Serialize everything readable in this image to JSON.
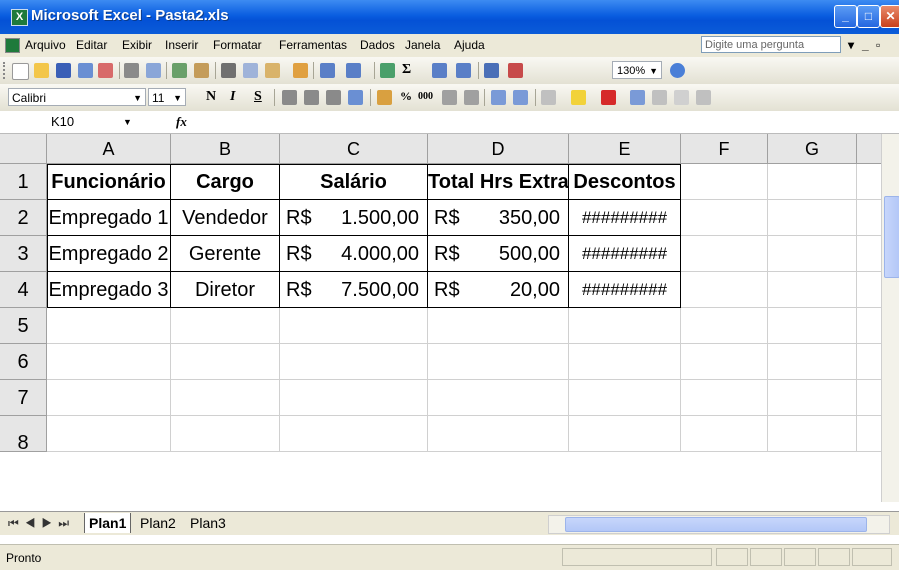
{
  "window": {
    "title": "Microsoft Excel - Pasta2.xls",
    "app_icon": "X"
  },
  "menubar": {
    "items": [
      "Arquivo",
      "Editar",
      "Exibir",
      "Inserir",
      "Formatar",
      "Ferramentas",
      "Dados",
      "Janela",
      "Ajuda"
    ],
    "help_placeholder": "Digite uma pergunta"
  },
  "toolbar": {
    "zoom": "130%",
    "font": "Calibri",
    "font_size": "11",
    "bold": "N",
    "italic": "I",
    "underline": "S"
  },
  "formula_bar": {
    "name_box": "K10",
    "fx": "fx",
    "content": ""
  },
  "columns": [
    "A",
    "B",
    "C",
    "D",
    "E",
    "F",
    "G"
  ],
  "rows": [
    "1",
    "2",
    "3",
    "4",
    "5",
    "6",
    "7",
    "8"
  ],
  "table": {
    "headers": {
      "A": "Funcionário",
      "B": "Cargo",
      "C": "Salário",
      "D": "Total Hrs Extras",
      "E": "Descontos"
    },
    "records": [
      {
        "name": "Empregado 1",
        "cargo": "Vendedor",
        "sal_cur": "R$",
        "sal": "1.500,00",
        "hrs_cur": "R$",
        "hrs": "350,00",
        "desc": "#########"
      },
      {
        "name": "Empregado 2",
        "cargo": "Gerente",
        "sal_cur": "R$",
        "sal": "4.000,00",
        "hrs_cur": "R$",
        "hrs": "500,00",
        "desc": "#########"
      },
      {
        "name": "Empregado 3",
        "cargo": "Diretor",
        "sal_cur": "R$",
        "sal": "7.500,00",
        "hrs_cur": "R$",
        "hrs": "20,00",
        "desc": "#########"
      }
    ]
  },
  "sheet_tabs": [
    "Plan1",
    "Plan2",
    "Plan3"
  ],
  "active_tab": "Plan1",
  "status": "Pronto",
  "colors": {
    "title_bar": "#0a5ee0",
    "chrome": "#ece9d8",
    "header_bg": "#e6e6e6"
  }
}
